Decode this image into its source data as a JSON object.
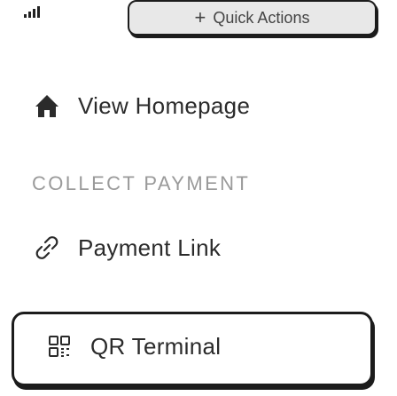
{
  "header": {
    "signal_icon": "signal-bars-icon",
    "quick_actions": {
      "icon": "plus-icon",
      "plus_glyph": "+",
      "label": "Quick Actions"
    }
  },
  "menu": {
    "view_homepage": {
      "icon": "home-icon",
      "label": "View Homepage"
    },
    "section_heading": "COLLECT PAYMENT",
    "payment_link": {
      "icon": "link-icon",
      "label": "Payment Link"
    },
    "qr_terminal": {
      "icon": "qr-code-icon",
      "label": "QR Terminal"
    }
  },
  "colors": {
    "text": "#2b2b2b",
    "muted": "#9a9a9a",
    "border": "#1c1c1c",
    "button_bg": "#e8e8e8"
  }
}
